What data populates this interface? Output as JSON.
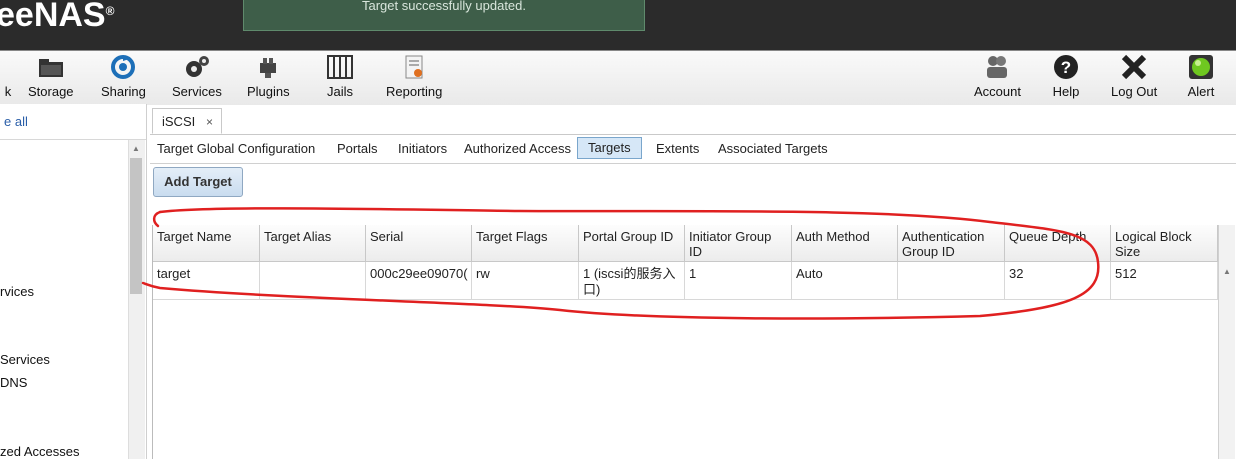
{
  "app": {
    "logo_text": "eeNAS",
    "logo_mark": "®"
  },
  "toast": {
    "message": "Target successfully updated."
  },
  "toolbar": {
    "left_items": [
      {
        "label": "k",
        "icon": "cut-off-icon"
      },
      {
        "label": "Storage",
        "icon": "folder-icon"
      },
      {
        "label": "Sharing",
        "icon": "sharing-icon"
      },
      {
        "label": "Services",
        "icon": "gears-icon"
      },
      {
        "label": "Plugins",
        "icon": "plugin-icon"
      },
      {
        "label": "Jails",
        "icon": "jail-bars-icon"
      },
      {
        "label": "Reporting",
        "icon": "report-icon"
      }
    ],
    "right_items": [
      {
        "label": "Account",
        "icon": "users-icon"
      },
      {
        "label": "Help",
        "icon": "help-icon"
      },
      {
        "label": "Log Out",
        "icon": "logout-x-icon"
      },
      {
        "label": "Alert",
        "icon": "alert-light-icon"
      }
    ]
  },
  "left_panel": {
    "items": [
      "e all",
      "rvices",
      "Services",
      "DNS",
      "zed Accesses"
    ]
  },
  "tabs": [
    {
      "label": "iSCSI",
      "close": "×"
    }
  ],
  "subnav": [
    "Target Global Configuration",
    "Portals",
    "Initiators",
    "Authorized Access",
    "Targets",
    "Extents",
    "Associated Targets"
  ],
  "subnav_active": "Targets",
  "add_button": "Add Target",
  "grid": {
    "columns": [
      "Target Name",
      "Target Alias",
      "Serial",
      "Target Flags",
      "Portal Group ID",
      "Initiator Group ID",
      "Auth Method",
      "Authentication Group ID",
      "Queue Depth",
      "Logical Block Size"
    ],
    "rows": [
      [
        "target",
        "",
        "000c29ee09070(",
        "rw",
        "1 (iscsi的服务入口)",
        "1",
        "Auto",
        "",
        "32",
        "512"
      ]
    ]
  },
  "colors": {
    "annotation": "#e02020",
    "active_tab": "#d6e7f7",
    "banner": "#2b2b2b",
    "toast_bg": "#3e5e49"
  }
}
